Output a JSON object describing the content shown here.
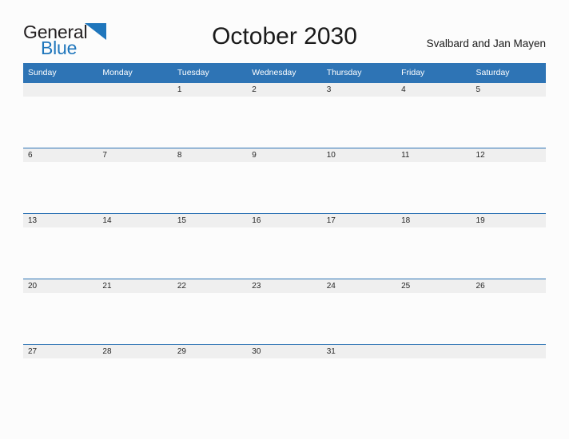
{
  "logo": {
    "text_top": "General",
    "text_bottom": "Blue",
    "flag_icon": "blue-triangle-flag-icon",
    "color_top": "#231f20",
    "color_bottom": "#1f76bc"
  },
  "header": {
    "title": "October 2030",
    "region": "Svalbard and Jan Mayen"
  },
  "calendar": {
    "accent_color": "#2e74b5",
    "band_color": "#efefef",
    "weekday_headers": [
      "Sunday",
      "Monday",
      "Tuesday",
      "Wednesday",
      "Thursday",
      "Friday",
      "Saturday"
    ],
    "weeks": [
      [
        "",
        "",
        "1",
        "2",
        "3",
        "4",
        "5"
      ],
      [
        "6",
        "7",
        "8",
        "9",
        "10",
        "11",
        "12"
      ],
      [
        "13",
        "14",
        "15",
        "16",
        "17",
        "18",
        "19"
      ],
      [
        "20",
        "21",
        "22",
        "23",
        "24",
        "25",
        "26"
      ],
      [
        "27",
        "28",
        "29",
        "30",
        "31",
        "",
        ""
      ]
    ]
  }
}
